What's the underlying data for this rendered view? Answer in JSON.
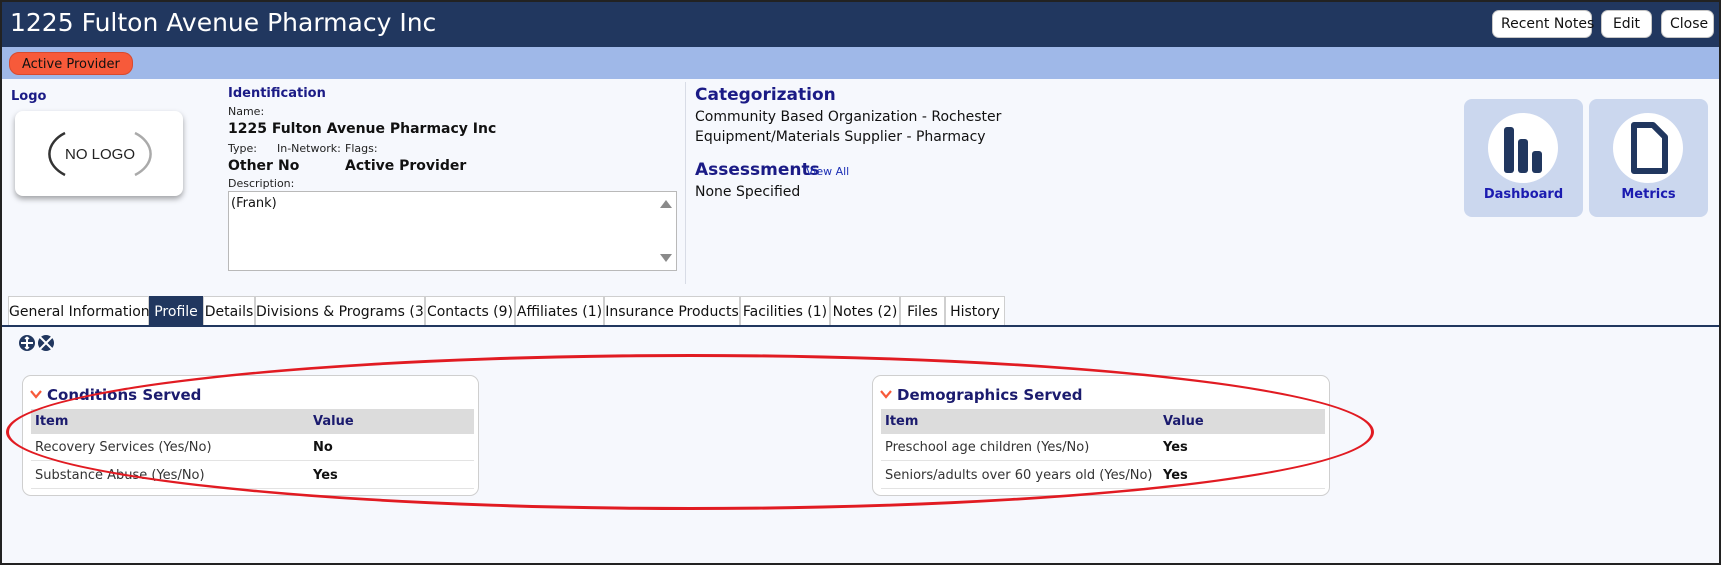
{
  "header": {
    "title": "1225 Fulton Avenue Pharmacy Inc",
    "buttons": {
      "recent_notes": "Recent Notes",
      "edit": "Edit",
      "close": "Close"
    }
  },
  "status": {
    "badge": "Active Provider"
  },
  "logo": {
    "heading": "Logo",
    "placeholder": "NO LOGO"
  },
  "identification": {
    "heading": "Identification",
    "name_label": "Name:",
    "name": "1225 Fulton Avenue Pharmacy Inc",
    "type_label": "Type:",
    "type": "Other",
    "in_network_label": "In-Network:",
    "in_network": "No",
    "flags_label": "Flags:",
    "flags": "Active Provider",
    "description_label": "Description:",
    "description": "(Frank)"
  },
  "categorization": {
    "heading": "Categorization",
    "items": [
      "Community Based Organization - Rochester",
      "Equipment/Materials Supplier - Pharmacy"
    ]
  },
  "assessments": {
    "heading": "Assessments",
    "view_all": "View All",
    "value": "None Specified"
  },
  "tiles": {
    "dashboard": "Dashboard",
    "metrics": "Metrics"
  },
  "tabs": [
    "General Information",
    "Profile",
    "Details",
    "Divisions & Programs (3)",
    "Contacts (9)",
    "Affiliates (1)",
    "Insurance Products",
    "Facilities (1)",
    "Notes (2)",
    "Files",
    "History"
  ],
  "active_tab": "Profile",
  "conditions": {
    "title": "Conditions Served",
    "col_item": "Item",
    "col_value": "Value",
    "rows": [
      {
        "item": "Recovery Services (Yes/No)",
        "value": "No"
      },
      {
        "item": "Substance Abuse (Yes/No)",
        "value": "Yes"
      }
    ]
  },
  "demographics": {
    "title": "Demographics Served",
    "col_item": "Item",
    "col_value": "Value",
    "rows": [
      {
        "item": "Preschool age children (Yes/No)",
        "value": "Yes"
      },
      {
        "item": "Seniors/adults over 60 years old (Yes/No)",
        "value": "Yes"
      }
    ]
  },
  "colors": {
    "header_bg": "#21375f",
    "status_bar": "#9fb8e8",
    "status_badge": "#f75a3a",
    "tile_bg": "#cbd7ee",
    "highlight": "#e11b22"
  }
}
